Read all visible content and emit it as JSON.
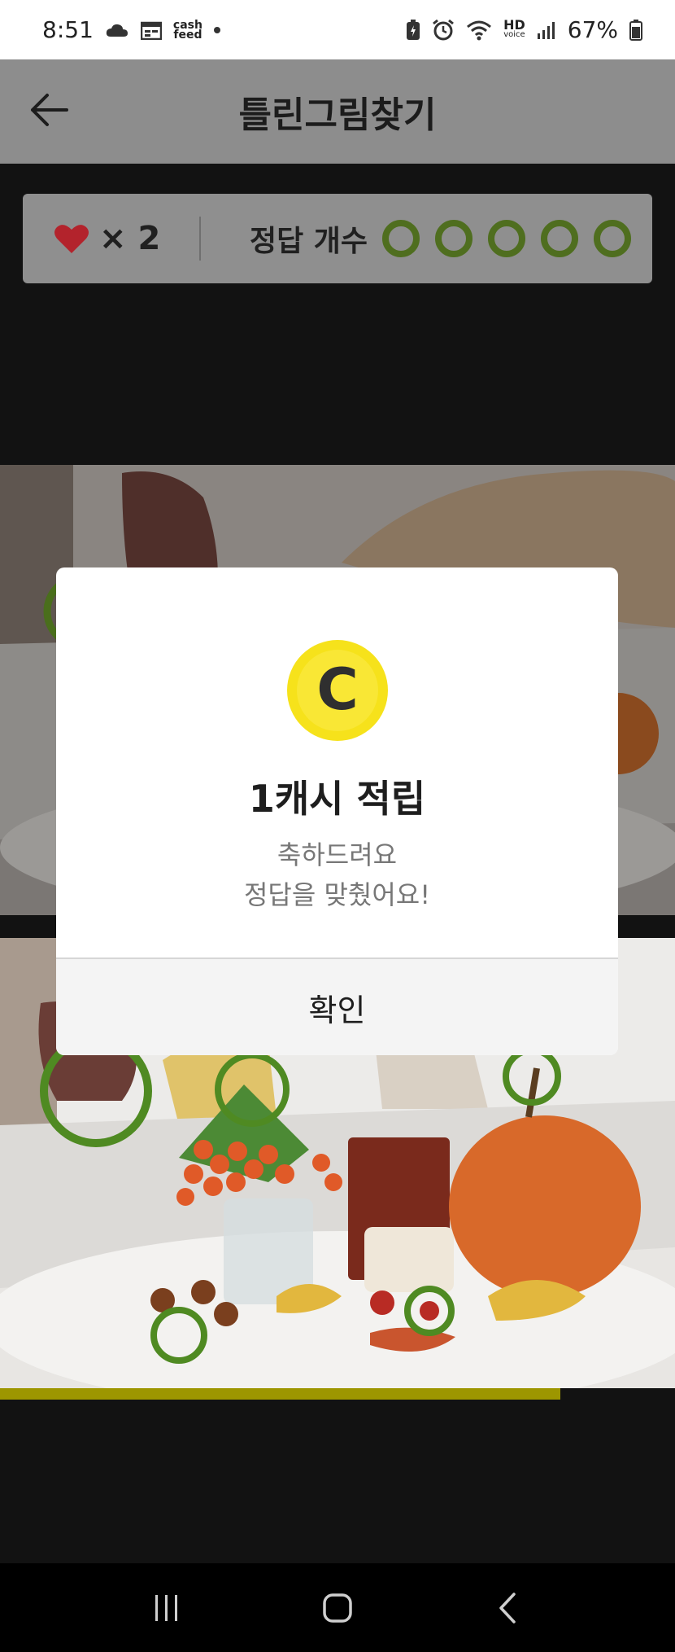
{
  "status_bar": {
    "time": "8:51",
    "cash_line1": "cash",
    "cash_line2": "feed",
    "hd_line1": "HD",
    "hd_line2": "voice",
    "battery": "67%",
    "icons": [
      "cloud-icon",
      "calendar-icon",
      "cashfeed-icon",
      "battery-saver-icon",
      "alarm-icon",
      "wifi-icon",
      "signal-icon",
      "battery-icon"
    ]
  },
  "header": {
    "title": "틀린그림찾기",
    "back_icon": "back-arrow-icon"
  },
  "score": {
    "lives_text": "× 2",
    "answer_label": "정답 개수",
    "answer_total": 5,
    "answers_found": 0,
    "colors": {
      "heart": "#c0202a",
      "ring": "#4f6e1f"
    }
  },
  "modal": {
    "coin_letter": "C",
    "title": "1캐시 적립",
    "message_line1": "축하드려요",
    "message_line2": "정답을 맞췄어요!",
    "confirm_label": "확인"
  },
  "progress": {
    "fraction": 0.83,
    "color": "#9d9600"
  },
  "nav": {
    "icons": [
      "recent-apps-icon",
      "home-icon",
      "back-icon"
    ]
  }
}
